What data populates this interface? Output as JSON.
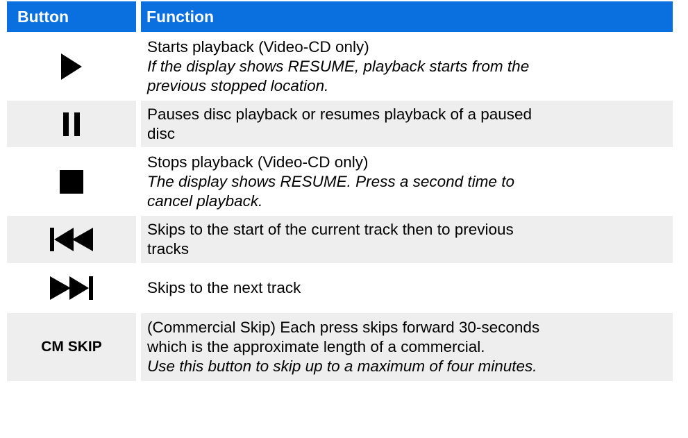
{
  "table": {
    "headers": {
      "button": "Button",
      "function": "Function"
    },
    "rows": [
      {
        "icon": "play-icon",
        "lines": [
          {
            "text": "Starts playback (Video-CD only)",
            "italic": false
          },
          {
            "text": "If the display shows RESUME, playback starts from the",
            "italic": true
          },
          {
            "text": "previous stopped location.",
            "italic": true
          }
        ]
      },
      {
        "icon": "pause-icon",
        "lines": [
          {
            "text": "Pauses disc playback or resumes playback of a paused",
            "italic": false
          },
          {
            "text": "disc",
            "italic": false
          }
        ]
      },
      {
        "icon": "stop-icon",
        "lines": [
          {
            "text": "Stops playback (Video-CD only)",
            "italic": false
          },
          {
            "text": "The display shows RESUME.  Press a second time to",
            "italic": true
          },
          {
            "text": "cancel playback.",
            "italic": true
          }
        ]
      },
      {
        "icon": "skip-previous-icon",
        "lines": [
          {
            "text": "Skips to the start of the current track then to previous",
            "italic": false
          },
          {
            "text": "tracks",
            "italic": false
          }
        ]
      },
      {
        "icon": "skip-next-icon",
        "lines": [
          {
            "text": "Skips to the next track",
            "italic": false
          }
        ]
      },
      {
        "label": "CM SKIP",
        "lines": [
          {
            "text": "(Commercial Skip) Each press skips forward 30-seconds",
            "italic": false
          },
          {
            "text": "which is the approximate length of a commercial.",
            "italic": false
          },
          {
            "text": "Use this button to skip up to a maximum of four minutes.",
            "italic": true
          }
        ]
      }
    ]
  },
  "colors": {
    "header_bg": "#0a70e0",
    "header_text": "#ffffff",
    "alt_row_bg": "#eeeeee"
  }
}
